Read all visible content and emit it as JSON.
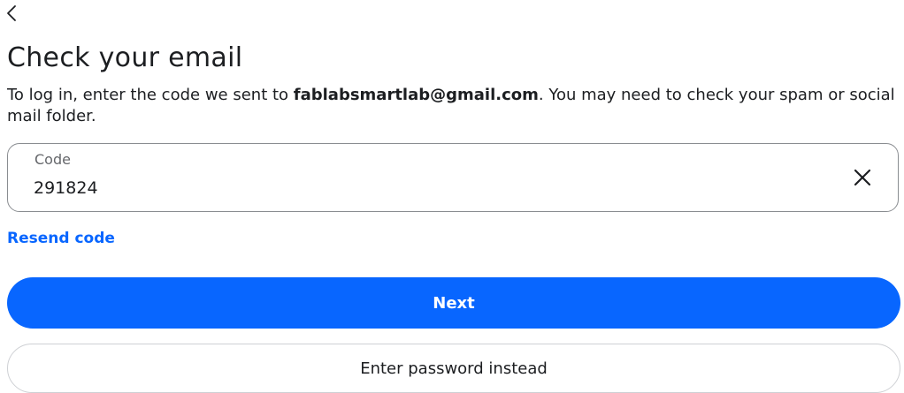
{
  "header": {
    "back_icon": "chevron-left-icon",
    "title": "Check your email"
  },
  "instructions": {
    "prefix": "To log in, enter the code we sent to ",
    "email": "fablabsmartlab@gmail.com",
    "suffix": ". You may need to check your spam or social mail folder."
  },
  "code_field": {
    "label": "Code",
    "value": "291824",
    "clear_icon": "close-icon"
  },
  "links": {
    "resend": "Resend code"
  },
  "buttons": {
    "next": "Next",
    "password": "Enter password instead"
  },
  "colors": {
    "accent": "#0866ff",
    "text": "#1c1e21",
    "muted": "#65676b",
    "border": "#8a8d91"
  }
}
